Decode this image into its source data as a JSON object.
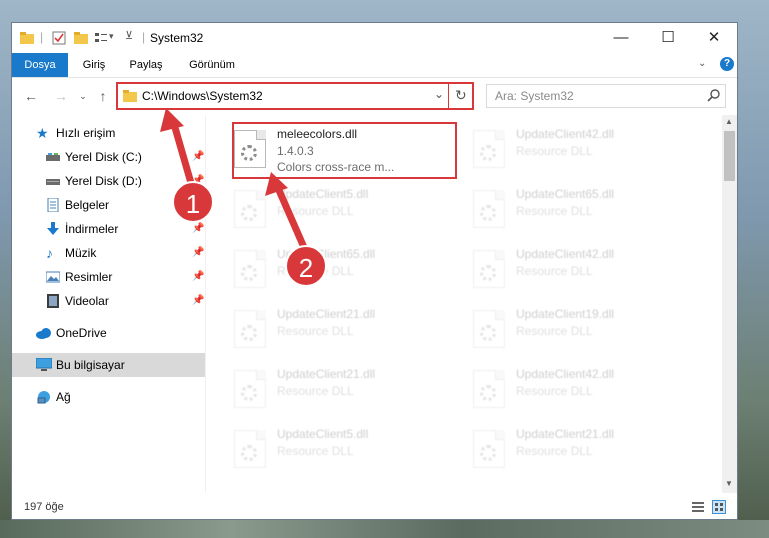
{
  "window": {
    "title": "System32",
    "controls": {
      "minimize": "—",
      "maximize": "☐",
      "close": "✕"
    }
  },
  "ribbon": {
    "tabs": [
      "Dosya",
      "Giriş",
      "Paylaş",
      "Görünüm"
    ],
    "help": "?"
  },
  "address": {
    "path": "C:\\Windows\\System32",
    "dropdown": "⌄",
    "refresh": "↻"
  },
  "search": {
    "placeholder": "Ara: System32"
  },
  "nav_pane": {
    "quick_access": "Hızlı erişim",
    "items": [
      {
        "label": "Yerel Disk (C:)",
        "icon": "drive-icon",
        "pinned": true
      },
      {
        "label": "Yerel Disk (D:)",
        "icon": "drive-icon",
        "pinned": true
      },
      {
        "label": "Belgeler",
        "icon": "documents-icon",
        "pinned": true
      },
      {
        "label": "İndirmeler",
        "icon": "downloads-icon",
        "pinned": true
      },
      {
        "label": "Müzik",
        "icon": "music-icon",
        "pinned": true
      },
      {
        "label": "Resimler",
        "icon": "pictures-icon",
        "pinned": true
      },
      {
        "label": "Videolar",
        "icon": "videos-icon",
        "pinned": true
      }
    ],
    "onedrive": "OneDrive",
    "this_pc": "Bu bilgisayar",
    "network": "Ağ"
  },
  "files": {
    "highlighted": {
      "name": "meleecolors.dll",
      "version": "1.4.0.3",
      "description": "Colors cross-race m..."
    },
    "left_column": [
      {
        "name": "UpdateClient5.dll",
        "type": "Resource DLL"
      },
      {
        "name": "UpdateClient65.dll",
        "type": "Resource DLL"
      },
      {
        "name": "UpdateClient21.dll",
        "type": "Resource DLL"
      },
      {
        "name": "UpdateClient21.dll",
        "type": "Resource DLL"
      },
      {
        "name": "UpdateClient5.dll",
        "type": "Resource DLL"
      }
    ],
    "right_column": [
      {
        "name": "UpdateClient42.dll",
        "type": "Resource DLL"
      },
      {
        "name": "UpdateClient65.dll",
        "type": "Resource DLL"
      },
      {
        "name": "UpdateClient42.dll",
        "type": "Resource DLL"
      },
      {
        "name": "UpdateClient19.dll",
        "type": "Resource DLL"
      },
      {
        "name": "UpdateClient42.dll",
        "type": "Resource DLL"
      },
      {
        "name": "UpdateClient21.dll",
        "type": "Resource DLL"
      }
    ]
  },
  "status": {
    "item_count": "197 öğe"
  },
  "callouts": {
    "one": "1",
    "two": "2"
  },
  "colors": {
    "accent": "#1979ca",
    "highlight": "#d9383a"
  }
}
